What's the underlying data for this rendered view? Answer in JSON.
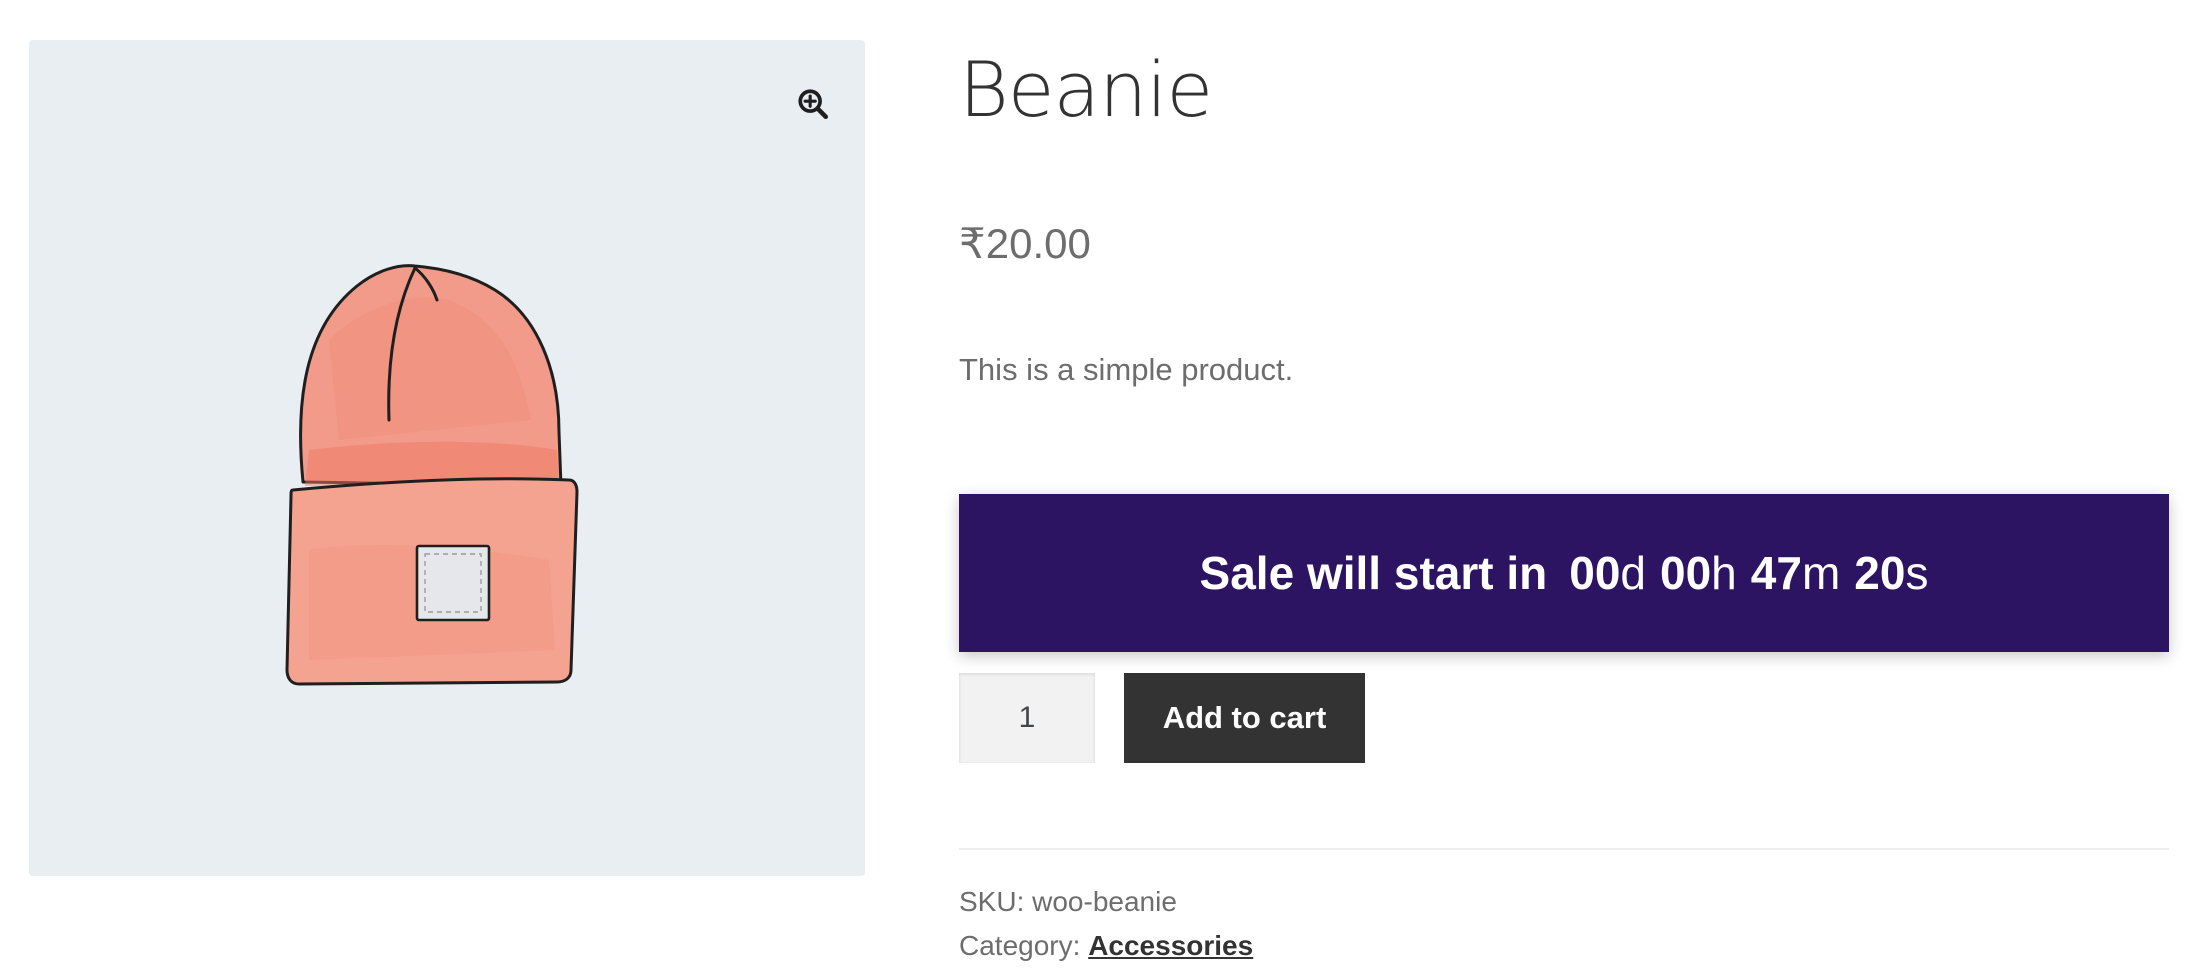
{
  "product": {
    "title": "Beanie",
    "price": "₹20.00",
    "short_description": "This is a simple product."
  },
  "gallery": {
    "image_icon": "beanie-illustration",
    "zoom_icon": "magnifier-zoom-in-icon",
    "background_color": "#e9eef3"
  },
  "countdown": {
    "lead_text": "Sale will start in",
    "days_value": "00",
    "days_unit": "d",
    "hours_value": "00",
    "hours_unit": "h",
    "minutes_value": "47",
    "minutes_unit": "m",
    "seconds_value": "20",
    "seconds_unit": "s",
    "background_color": "#2c1463",
    "text_color": "#ffffff"
  },
  "cart": {
    "quantity_value": "1",
    "add_to_cart_label": "Add to cart",
    "button_color": "#333333"
  },
  "meta": {
    "sku_label": "SKU:",
    "sku_value": "woo-beanie",
    "category_label": "Category:",
    "category_value": "Accessories"
  }
}
